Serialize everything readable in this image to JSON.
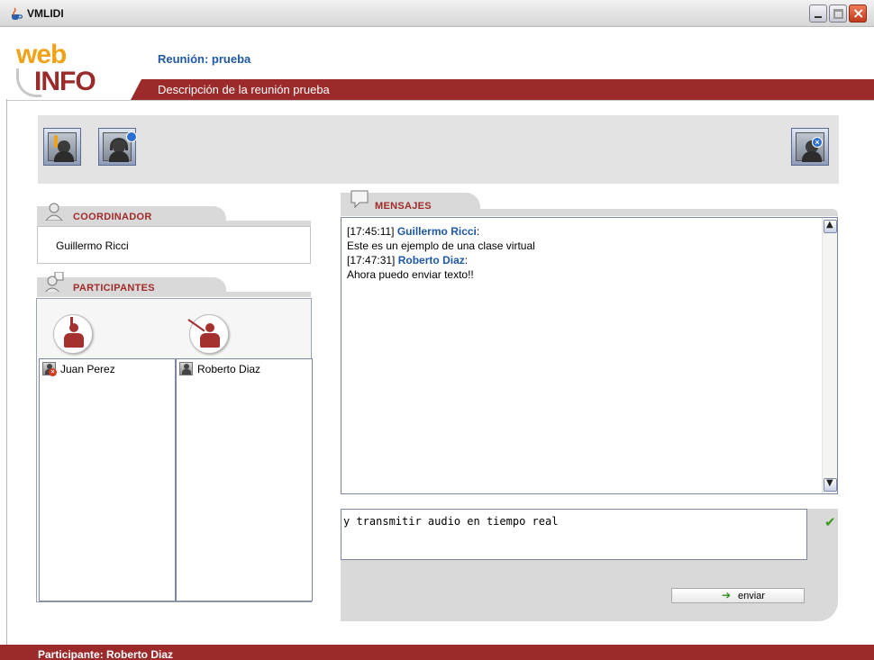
{
  "window": {
    "title": "VMLIDI",
    "minimize_label": "minimize",
    "maximize_label": "maximize",
    "close_label": "close"
  },
  "header": {
    "logo_top": "web",
    "logo_bottom": "INFO",
    "meeting_title": "Reunión: prueba",
    "meeting_description": "Descripción de la reunión prueba"
  },
  "toolbar": {
    "icons": [
      "raise-hand-icon",
      "audio-headset-icon",
      "exit-meeting-icon"
    ]
  },
  "coordinator": {
    "section_label": "COORDINADOR",
    "name": "Guillermo Ricci"
  },
  "participants": {
    "section_label": "PARTICIPANTES",
    "left_list": [
      {
        "name": "Juan Perez",
        "status": "muted"
      }
    ],
    "right_list": [
      {
        "name": "Roberto Diaz",
        "status": "active"
      }
    ]
  },
  "messages": {
    "section_label": "MENSAJES",
    "items": [
      {
        "time": "[17:45:11]",
        "author": "Guillermo Ricci",
        "text": "Este es un ejemplo de una clase virtual"
      },
      {
        "time": "[17:47:31]",
        "author": "Roberto Diaz",
        "text": "Ahora puedo enviar texto!!"
      }
    ]
  },
  "composer": {
    "value": "y transmitir audio en tiempo real",
    "send_label": "enviar"
  },
  "footer": {
    "label": "Participante:  Roberto Diaz"
  },
  "colors": {
    "brand_red": "#9c2a2a",
    "brand_orange": "#f0a218",
    "link_blue": "#1f58a3",
    "panel_gray": "#d9d9d9"
  }
}
